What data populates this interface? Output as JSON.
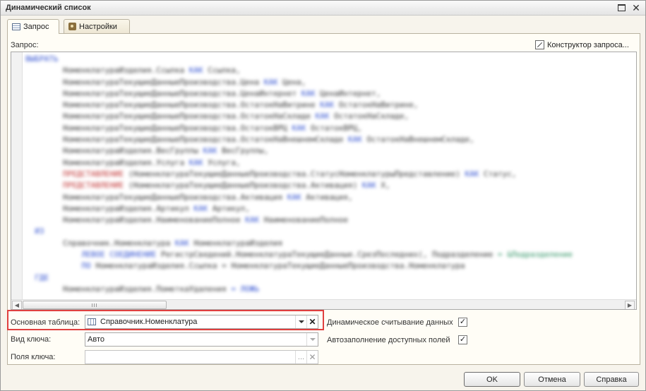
{
  "window": {
    "title": "Динамический список"
  },
  "tabs": [
    {
      "label": "Запрос",
      "active": true
    },
    {
      "label": "Настройки",
      "active": false
    }
  ],
  "query": {
    "label": "Запрос:",
    "constructor_label": "Конструктор запроса...",
    "code_lines": [
      [
        [
          "kw",
          "ВЫБРАТЬ"
        ]
      ],
      [
        [
          "",
          "        НоменклатураИзделия.Ссылка "
        ],
        [
          "kw",
          "КАК"
        ],
        [
          "",
          " Ссылка,"
        ]
      ],
      [
        [
          "",
          "        НоменклатураТекущиеДанныеПроизводства.Цена "
        ],
        [
          "kw",
          "КАК"
        ],
        [
          "",
          " Цена,"
        ]
      ],
      [
        [
          "",
          "        НоменклатураТекущиеДанныеПроизводства.ЦенаИнтернет "
        ],
        [
          "kw",
          "КАК"
        ],
        [
          "",
          " ЦенаИнтернет,"
        ]
      ],
      [
        [
          "",
          "        НоменклатураТекущиеДанныеПроизводства.ОстатокНаВитрине "
        ],
        [
          "kw",
          "КАК"
        ],
        [
          "",
          " ОстатокНаВитрине,"
        ]
      ],
      [
        [
          "",
          "        НоменклатураТекущиеДанныеПроизводства.ОстатокНаСкладе "
        ],
        [
          "kw",
          "КАК"
        ],
        [
          "",
          " ОстатокНаСкладе,"
        ]
      ],
      [
        [
          "",
          "        НоменклатураТекущиеДанныеПроизводства.ОстатокВРЦ "
        ],
        [
          "kw",
          "КАК"
        ],
        [
          "",
          " ОстатокВРЦ,"
        ]
      ],
      [
        [
          "",
          "        НоменклатураТекущиеДанныеПроизводства.ОстатокНаВнешнемСкладе "
        ],
        [
          "kw",
          "КАК"
        ],
        [
          "",
          " ОстатокНаВнешнемСкладе,"
        ]
      ],
      [
        [
          "",
          "        НоменклатураИзделия.ВесГруппы "
        ],
        [
          "kw",
          "КАК"
        ],
        [
          "",
          " ВесГруппы,"
        ]
      ],
      [
        [
          "",
          "        НоменклатураИзделия.Услуга "
        ],
        [
          "kw",
          "КАК"
        ],
        [
          "",
          " Услуга,"
        ]
      ],
      [
        [
          "fn",
          "        ПРЕДСТАВЛЕНИЕ"
        ],
        [
          "",
          " (НоменклатураТекущиеДанныеПроизводства.СтатусНоменклатурыПредставление) "
        ],
        [
          "kw",
          "КАК"
        ],
        [
          "",
          " Статус,"
        ]
      ],
      [
        [
          "fn",
          "        ПРЕДСТАВЛЕНИЕ"
        ],
        [
          "",
          " (НоменклатураТекущиеДанныеПроизводства.Активация) "
        ],
        [
          "kw",
          "КАК"
        ],
        [
          "",
          " Х,"
        ]
      ],
      [
        [
          "",
          "        НоменклатураТекущиеДанныеПроизводства.Активация "
        ],
        [
          "kw",
          "КАК"
        ],
        [
          "",
          " Активация,"
        ]
      ],
      [
        [
          "",
          "        НоменклатураИзделия.Артикул "
        ],
        [
          "kw",
          "КАК"
        ],
        [
          "",
          " Артикул,"
        ]
      ],
      [
        [
          "",
          "        НоменклатураИзделия.НаименованиеПолное "
        ],
        [
          "kw",
          "КАК"
        ],
        [
          "",
          " НаименованиеПолное"
        ]
      ],
      [
        [
          "kw",
          "  ИЗ"
        ]
      ],
      [
        [
          "",
          "        Справочник.Номенклатура "
        ],
        [
          "kw",
          "КАК"
        ],
        [
          "",
          " НоменклатураИзделия"
        ]
      ],
      [
        [
          "kw",
          "            ЛЕВОЕ СОЕДИНЕНИЕ"
        ],
        [
          "",
          " РегистрСведений.НоменклатураТекущиеДанные.СрезПоследних(, Подразделение "
        ],
        [
          "gr",
          "= &Подразделение"
        ]
      ],
      [
        [
          "kw",
          "            ПО"
        ],
        [
          "",
          " НоменклатураИзделия.Ссылка = НоменклатураТекущиеДанныеПроизводства.Номенклатура"
        ]
      ],
      [
        [
          "kw",
          "  ГДЕ"
        ]
      ],
      [
        [
          "",
          "        НоменклатураИзделия.ПометкаУдаления "
        ],
        [
          "kw",
          "= ЛОЖЬ"
        ]
      ]
    ]
  },
  "form": {
    "main_table_label": "Основная таблица:",
    "main_table_value": "Справочник.Номенклатура",
    "key_type_label": "Вид ключа:",
    "key_type_value": "Авто",
    "key_fields_label": "Поля ключа:",
    "key_fields_value": "",
    "key_fields_button": "...",
    "dynamic_read_label": "Динамическое считывание данных",
    "dynamic_read_checked": true,
    "autofill_label": "Автозаполнение доступных полей",
    "autofill_checked": true
  },
  "buttons": {
    "ok": "OK",
    "cancel": "Отмена",
    "help": "Справка"
  },
  "colors": {
    "highlight_box": "#e04040",
    "keyword": "#3050d0",
    "function": "#c03030"
  }
}
